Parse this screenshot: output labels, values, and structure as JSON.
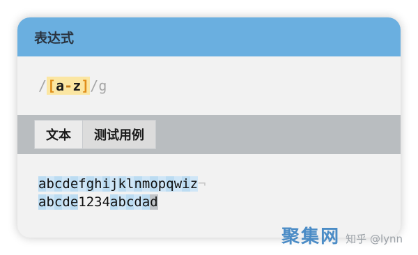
{
  "panel": {
    "title": "表达式"
  },
  "expression": {
    "open_slash": "/",
    "open_bracket": "[",
    "range_start": "a",
    "range_hyphen": "-",
    "range_end": "z",
    "close_bracket": "]",
    "close_slash": "/",
    "flags": "g"
  },
  "tabs": [
    {
      "label": "文本"
    },
    {
      "label": "测试用例"
    }
  ],
  "test_text": {
    "line1": [
      "a",
      "b",
      "c",
      "d",
      "e",
      "f",
      "g",
      "h",
      "i",
      "j",
      "k",
      "l",
      "n",
      "m",
      "o",
      "p",
      "q",
      "w",
      "i",
      "z"
    ],
    "line1_end": "¬",
    "line2_a": [
      "a",
      "b",
      "c",
      "d",
      "e"
    ],
    "line2_digits": "1234",
    "line2_b": [
      "a",
      "b",
      "c",
      "d",
      "a",
      "d"
    ]
  },
  "watermark": {
    "logo_text": "聚集网",
    "credit": "知乎 @lynn"
  },
  "colors": {
    "header": "#6aafe0",
    "match": "#bcdcf2",
    "bracket": "#e08e1a",
    "set_highlight": "#fbe6a2"
  }
}
